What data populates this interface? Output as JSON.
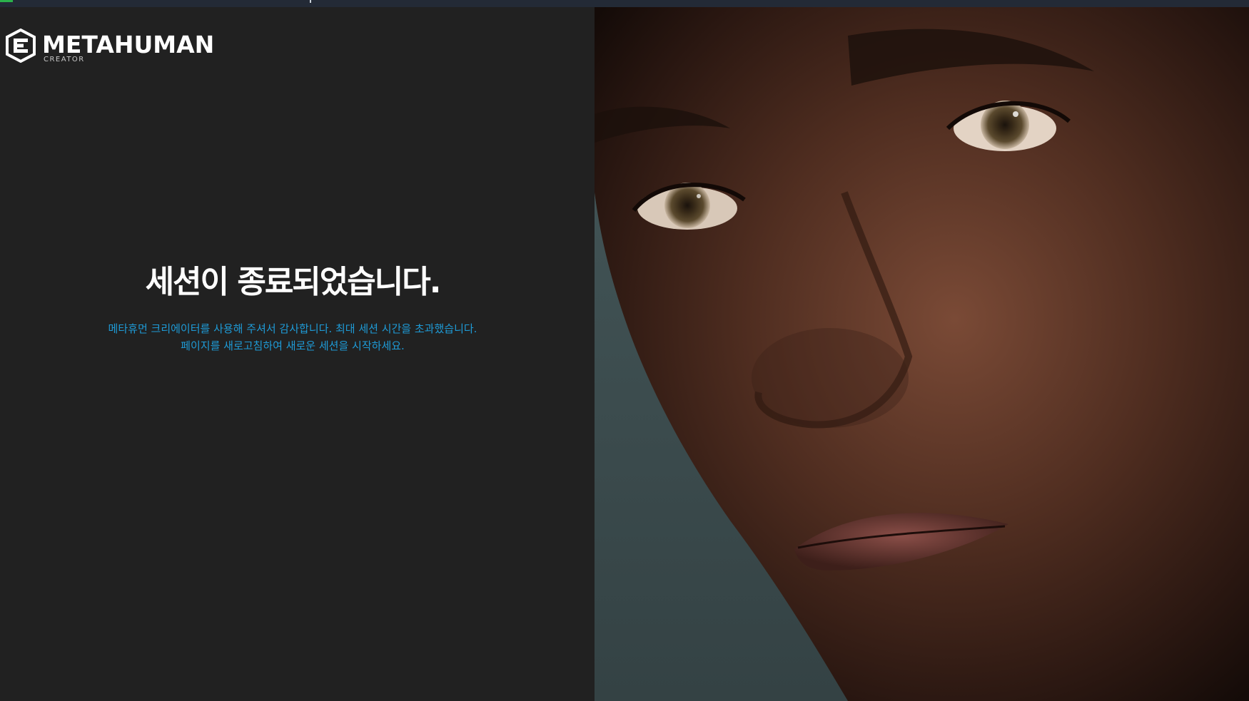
{
  "brand": {
    "title": "METAHUMAN",
    "subtitle": "CREATOR",
    "colors": {
      "background": "#212121",
      "headline": "#ffffff",
      "link_text": "#1e9bd7"
    }
  },
  "session": {
    "headline": "세션이 종료되었습니다.",
    "message": "메타휴먼 크리에이터를 사용해 주셔서 감사합니다. 최대 세션 시간을 초과했습니다. 페이지를 새로고침하여 새로운 세션을 시작하세요."
  },
  "hero_image": {
    "icon": "portrait-photo",
    "description_visible": false
  }
}
